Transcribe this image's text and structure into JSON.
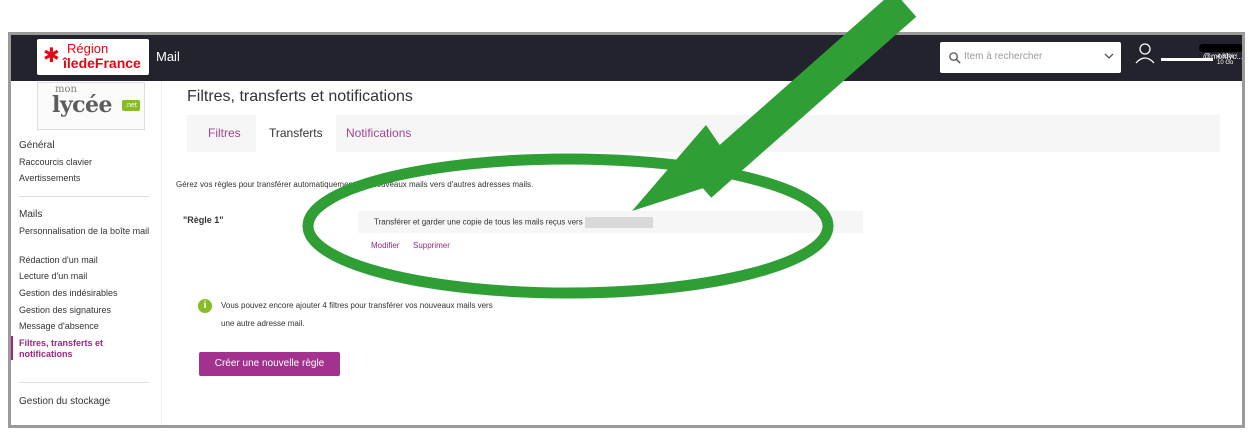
{
  "header": {
    "region_logo_line1": "Région",
    "region_logo_line2": "îledeFrance",
    "app_title": "Mail",
    "search_placeholder": "Item à rechercher",
    "user_name": "@monlyc...",
    "quota_text": "4.33% / 10 Go",
    "quota_fraction": 0.0433
  },
  "sidebar": {
    "logo_mon": "mon",
    "logo_lycee": "lycée",
    "logo_net": ".net",
    "general_heading": "Général",
    "general_items": [
      "Raccourcis clavier",
      "Avertissements"
    ],
    "mails_heading": "Mails",
    "mail_items": [
      "Personnalisation de la boîte mail",
      "Rédaction d'un mail",
      "Lecture d'un mail",
      "Gestion des indésirables",
      "Gestion des signatures",
      "Message d'absence",
      "Filtres, transferts et notifications"
    ],
    "storage_heading": "Gestion du stockage"
  },
  "main": {
    "page_title": "Filtres, transferts et notifications",
    "tabs": [
      "Filtres",
      "Transferts",
      "Notifications"
    ],
    "active_tab": "Transferts",
    "intro": "Gérez vos règles pour transférer automatiquement vos nouveaux mails vers d'autres adresses mails.",
    "rule_name": "\"Règle 1\"",
    "rule_text": "Transférer et garder une copie de tous les mails reçus vers",
    "modify_label": "Modifier",
    "delete_label": "Supprimer",
    "info_line1": "Vous pouvez encore ajouter 4 filtres pour transférer vos nouveaux mails vers",
    "info_line2": "une autre adresse mail.",
    "create_button": "Créer une nouvelle règle"
  },
  "annotation": {
    "arrow_color": "#2f9e35",
    "ellipse_color": "#2f9e35"
  }
}
